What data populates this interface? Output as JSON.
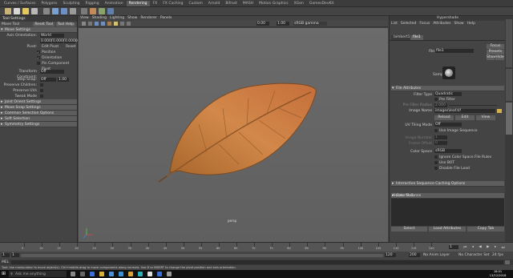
{
  "shelf": {
    "tabs": [
      "Curves / Surfaces",
      "Polygons",
      "Sculpting",
      "Rigging",
      "Animation",
      "Rendering",
      "FX",
      "FX Caching",
      "Custom",
      "Arnold",
      "Bifrost",
      "MASH",
      "Motion Graphics",
      "XGen",
      "GamesDevKit"
    ],
    "active_index": 5
  },
  "tool_settings": {
    "panel_title": "Tool Settings",
    "tool_name": "Move Tool",
    "reset_label": "Reset Tool",
    "help_label": "Tool Help",
    "move_settings": {
      "header": "Move Settings",
      "axis_orientation_label": "Axis Orientation:",
      "axis_orientation_value": "World",
      "coords": [
        "0.0000",
        "0.0000",
        "0.0000"
      ],
      "pivot_label": "Pivot:",
      "edit_pivot_label": "Edit Pivot",
      "reset_label": "Reset",
      "position_label": "Position",
      "orientation_label": "Orientation",
      "pin_component_pivot_label": "Pin Component Pivot",
      "transform_constraint_label": "Transform Constraint:",
      "transform_constraint_value": "Off",
      "step_snap_label": "Step Snap:",
      "step_snap_value": "Off",
      "step_snap_number": "1.00",
      "preserve_children_label": "Preserve Children:",
      "preserve_uvs_label": "Preserve UVs",
      "tweak_mode_label": "Tweak Mode"
    },
    "frames": [
      "Joint Orient Settings",
      "Move Snap Settings",
      "Common Selection Options",
      "Soft Selection",
      "Symmetry Settings"
    ]
  },
  "viewport": {
    "menu": [
      "View",
      "Shading",
      "Lighting",
      "Show",
      "Renderer",
      "Panels"
    ],
    "gamma_label": "sRGB gamma",
    "num_a": "0.00",
    "num_b": "1.00",
    "camera_label": "persp"
  },
  "attribute_editor": {
    "title": "Hypershade",
    "menu": [
      "List",
      "Selected",
      "Focus",
      "Attributes",
      "Show",
      "Help"
    ],
    "tabs": [
      "lambert1",
      "file1"
    ],
    "active_tab": 1,
    "file_label": "file:",
    "file_value": "file1",
    "focus_label": "Focus",
    "presets_label": "Presets",
    "show_label": "Show",
    "hide_label": "Hide",
    "sample_label": "Sample",
    "section_file_attrs": "File Attributes",
    "filter_type_label": "Filter Type",
    "filter_type_value": "Quadratic",
    "pre_filter_label": "Pre Filter",
    "pre_filter_radius_label": "Pre Filter Radius",
    "pre_filter_radius_value": "2.000",
    "image_name_label": "Image Name",
    "image_name_value": "images\\leaf.tif",
    "reload_label": "Reload",
    "edit_label": "Edit",
    "view_label": "View",
    "uv_tiling_label": "UV Tiling Mode",
    "uv_tiling_value": "Off",
    "use_image_sequence_label": "Use Image Sequence",
    "image_number_label": "Image Number",
    "image_number_value": "1",
    "frame_offset_label": "Frame Offset",
    "frame_offset_value": "0",
    "color_space_label": "Color Space",
    "color_space_value": "sRGB",
    "ignore_cs_rules_label": "Ignore Color Space File Rules",
    "use_bot_label": "Use BOT",
    "disable_file_load_label": "Disable File Load",
    "collapsed_sections": [
      "Interactive Sequence Caching Options",
      "Color Balance",
      "Effects"
    ],
    "notes_label": "Notes:",
    "notes_value": "file1",
    "select_label": "Select",
    "load_attributes_label": "Load Attributes",
    "copy_tab_label": "Copy Tab"
  },
  "side_tabs": [
    "Channel Box / Layer Editor",
    "Modelling Toolkit",
    "Attribute Editor"
  ],
  "timeline": {
    "ticks": [
      "5",
      "10",
      "15",
      "20",
      "25",
      "30",
      "35",
      "40",
      "45",
      "50",
      "55",
      "60",
      "65",
      "70",
      "75",
      "80",
      "85",
      "90",
      "95",
      "100",
      "105",
      "110",
      "115",
      "120"
    ],
    "current_frame": "1"
  },
  "range": {
    "start": "1",
    "start_inner": "1",
    "end_inner": "120",
    "end": "120",
    "end_outer": "200",
    "anim_layer_label": "No Anim Layer",
    "char_set_label": "No Character Set",
    "fps_label": "24 fps"
  },
  "cmd_line": {
    "lang": "MEL"
  },
  "help_line": "Tool: Use manipulator to move object(s). Ctrl+middle-drag to move components along normals. Use D or INSERT to change the pivot position and axis orientation.",
  "taskbar": {
    "search_placeholder": "Ask me anything",
    "time": "18:01",
    "date": "13/12/2018"
  }
}
